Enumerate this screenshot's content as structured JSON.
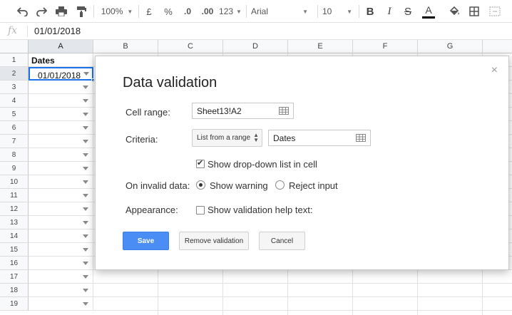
{
  "toolbar": {
    "zoom": "100%",
    "currency": "£",
    "percent": "%",
    "dec_less": ".0",
    "dec_more": ".00",
    "more_formats": "123",
    "font": "Arial",
    "font_size": "10",
    "bold": "B",
    "italic": "I",
    "strike": "S",
    "text_color": "A"
  },
  "formula_bar": {
    "fx": "fx",
    "value": "01/01/2018"
  },
  "grid": {
    "columns": [
      "A",
      "B",
      "C",
      "D",
      "E",
      "F",
      "G"
    ],
    "rows": [
      "1",
      "2",
      "3",
      "4",
      "5",
      "6",
      "7",
      "8",
      "9",
      "10",
      "11",
      "12",
      "13",
      "14",
      "15",
      "16",
      "17",
      "18",
      "19"
    ],
    "a1": "Dates",
    "a2": "01/01/2018"
  },
  "dialog": {
    "title": "Data validation",
    "close": "×",
    "cell_range_label": "Cell range:",
    "cell_range_value": "Sheet13!A2",
    "criteria_label": "Criteria:",
    "criteria_option": "List from a range",
    "criteria_value": "Dates",
    "show_dropdown_label": "Show drop-down list in cell",
    "invalid_label": "On invalid data:",
    "show_warning_label": "Show warning",
    "reject_input_label": "Reject input",
    "appearance_label": "Appearance:",
    "help_text_label": "Show validation help text:",
    "save": "Save",
    "remove": "Remove validation",
    "cancel": "Cancel"
  },
  "colors": {
    "accent": "#4a8ef5",
    "selection": "#1a73e8"
  }
}
